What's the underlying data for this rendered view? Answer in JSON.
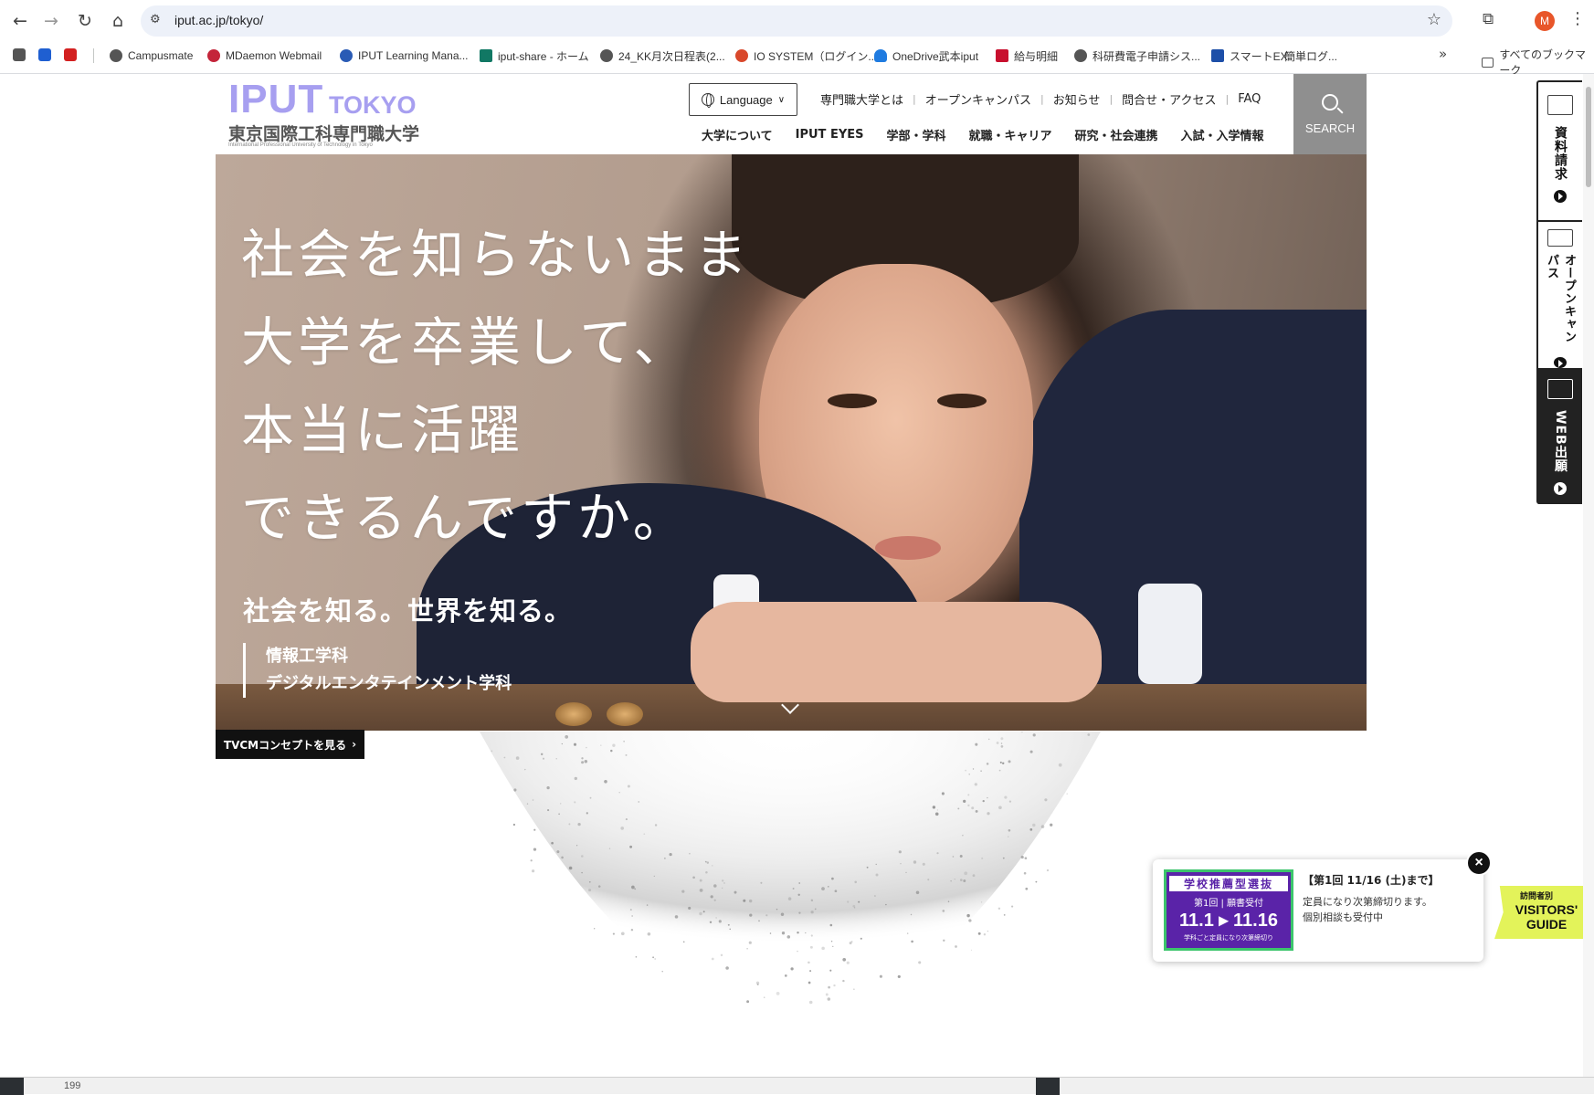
{
  "browser": {
    "url": "iput.ac.jp/tokyo/",
    "profile_initial": "M",
    "bookmarks": [
      "Campusmate",
      "MDaemon Webmail",
      "IPUT Learning Mana...",
      "iput-share - ホーム",
      "24_KK月次日程表(2...",
      "IO SYSTEM（ログイン...",
      "OneDrive武本iput",
      "給与明細",
      "科研費電子申請シス...",
      "スマートEX",
      "簡単ログ..."
    ],
    "all_bookmarks": "すべてのブックマーク",
    "more": "»"
  },
  "header": {
    "logo_iput": "IPUT",
    "logo_tokyo": "TOKYO",
    "logo_jp": "東京国際工科専門職大学",
    "logo_en": "International Professional University of Technology in Tokyo",
    "language": "Language",
    "util_nav": [
      "専門職大学とは",
      "オープンキャンパス",
      "お知らせ",
      "問合せ・アクセス",
      "FAQ"
    ],
    "main_nav": [
      "大学について",
      "IPUT EYES",
      "学部・学科",
      "就職・キャリア",
      "研究・社会連携",
      "入試・入学情報"
    ],
    "search": "SEARCH"
  },
  "hero": {
    "catch_lines": [
      "社会を知らないまま",
      "大学を卒業して、",
      "本当に活躍",
      "できるんですか。"
    ],
    "sub": "社会を知る。世界を知る。",
    "departments": [
      "情報工学科",
      "デジタルエンタテインメント学科"
    ],
    "tvcm": "TVCMコンセプトを見る"
  },
  "side_tabs": [
    "資料請求",
    "オープンキャンパス",
    "WEB出願"
  ],
  "popup": {
    "banner_title": "学校推薦型選抜",
    "banner_round": "第1回 | 願書受付",
    "banner_dates": "11.1 ▸ 11.16",
    "banner_note": "学科ごと定員になり次第締切り",
    "title": "【第1回 11/16 (土)まで】",
    "line1": "定員になり次第締切ります。",
    "line2": "個別相談も受付中",
    "close": "×"
  },
  "visitors": {
    "label_jp": "訪問者別",
    "label_en": "VISITORS' GUIDE"
  },
  "taskbar": {
    "number": "199"
  }
}
